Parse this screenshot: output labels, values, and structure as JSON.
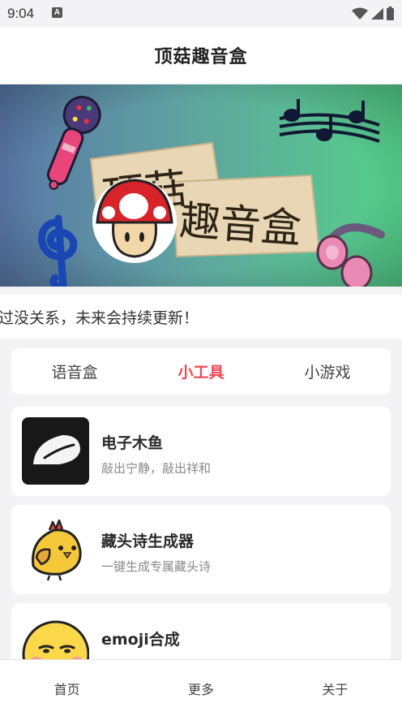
{
  "status_bar": {
    "time": "9:04",
    "a_badge": "A",
    "icons": [
      "wifi-icon",
      "signal-icon",
      "battery-icon"
    ]
  },
  "header": {
    "title": "顶菇趣音盒"
  },
  "banner": {
    "text_line1": "顶菇",
    "text_line2": "趣音盒"
  },
  "notice": {
    "text": "过没关系，未来会持续更新！"
  },
  "tabs": [
    {
      "label": "语音盒",
      "active": false
    },
    {
      "label": "小工具",
      "active": true
    },
    {
      "label": "小游戏",
      "active": false
    }
  ],
  "tools": [
    {
      "title": "电子木鱼",
      "subtitle": "敲出宁静，敲出祥和",
      "icon": "wooden-fish-icon"
    },
    {
      "title": "藏头诗生成器",
      "subtitle": "一键生成专属藏头诗",
      "icon": "chick-icon"
    },
    {
      "title": "emoji合成",
      "subtitle": "",
      "icon": "emoji-face-icon"
    }
  ],
  "bottom_nav": [
    {
      "label": "首页"
    },
    {
      "label": "更多"
    },
    {
      "label": "关于"
    }
  ],
  "colors": {
    "accent": "#f04a55",
    "background": "#f3f3f5",
    "card": "#ffffff"
  }
}
